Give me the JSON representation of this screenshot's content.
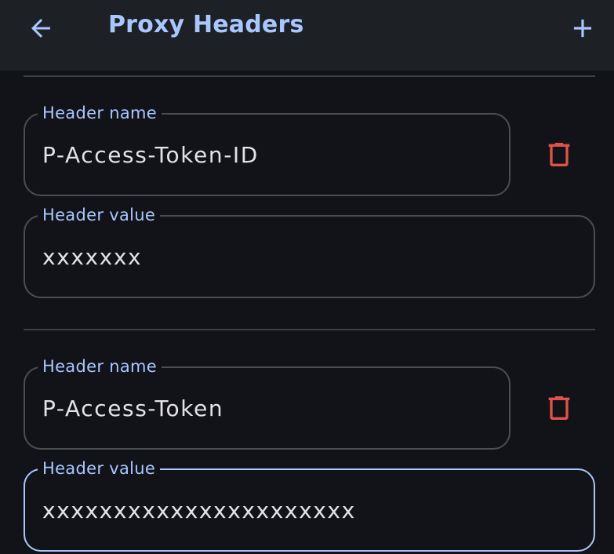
{
  "header": {
    "title": "Proxy Headers",
    "back_icon": "arrow-left-icon",
    "add_icon": "plus-icon"
  },
  "colors": {
    "accent": "#a9c7ff",
    "background": "#121318",
    "toolbar": "#1d2025",
    "danger": "#e0524a",
    "text": "#e3e2e6",
    "outline": "#4a4d52"
  },
  "headers": [
    {
      "name_label": "Header name",
      "name_value": "P-Access-Token-ID",
      "value_label": "Header value",
      "value_value": "xxxxxxx",
      "delete_icon": "trash-icon"
    },
    {
      "name_label": "Header name",
      "name_value": "P-Access-Token",
      "value_label": "Header value",
      "value_value": "xxxxxxxxxxxxxxxxxxxxxx",
      "delete_icon": "trash-icon"
    }
  ]
}
